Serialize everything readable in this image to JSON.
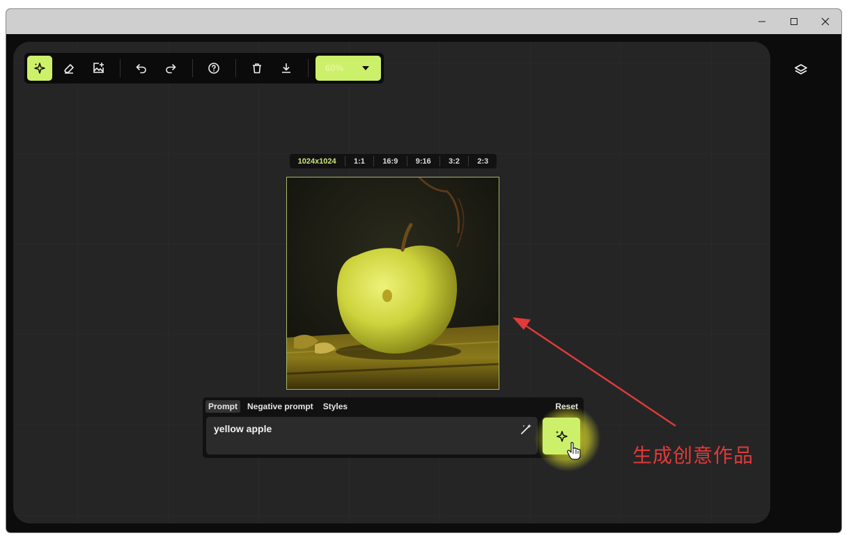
{
  "window": {
    "controls": {
      "minimize": "minimize-icon",
      "maximize": "maximize-icon",
      "close": "close-icon"
    }
  },
  "toolbar": {
    "tools": [
      {
        "name": "generate-tool",
        "icon": "sparkle-icon",
        "active": true
      },
      {
        "name": "eraser-tool",
        "icon": "eraser-icon",
        "active": false
      },
      {
        "name": "add-image-tool",
        "icon": "image-plus-icon",
        "active": false
      },
      {
        "name": "undo",
        "icon": "undo-icon"
      },
      {
        "name": "redo",
        "icon": "redo-icon"
      },
      {
        "name": "help",
        "icon": "help-circle-icon"
      },
      {
        "name": "delete",
        "icon": "trash-icon"
      },
      {
        "name": "download",
        "icon": "download-icon"
      }
    ],
    "zoom": "60%"
  },
  "size_presets": {
    "selected": "1024x1024",
    "items": [
      "1024x1024",
      "1:1",
      "16:9",
      "9:16",
      "3:2",
      "2:3"
    ]
  },
  "prompt_panel": {
    "tabs": [
      "Prompt",
      "Negative prompt",
      "Styles"
    ],
    "selected_tab": "Prompt",
    "reset_label": "Reset",
    "value": "yellow apple"
  },
  "annotation": {
    "text": "生成创意作品",
    "color": "#e03a3a"
  },
  "colors": {
    "accent": "#cdf06a",
    "canvas": "#252525",
    "titlebar": "#cfcfcf"
  }
}
